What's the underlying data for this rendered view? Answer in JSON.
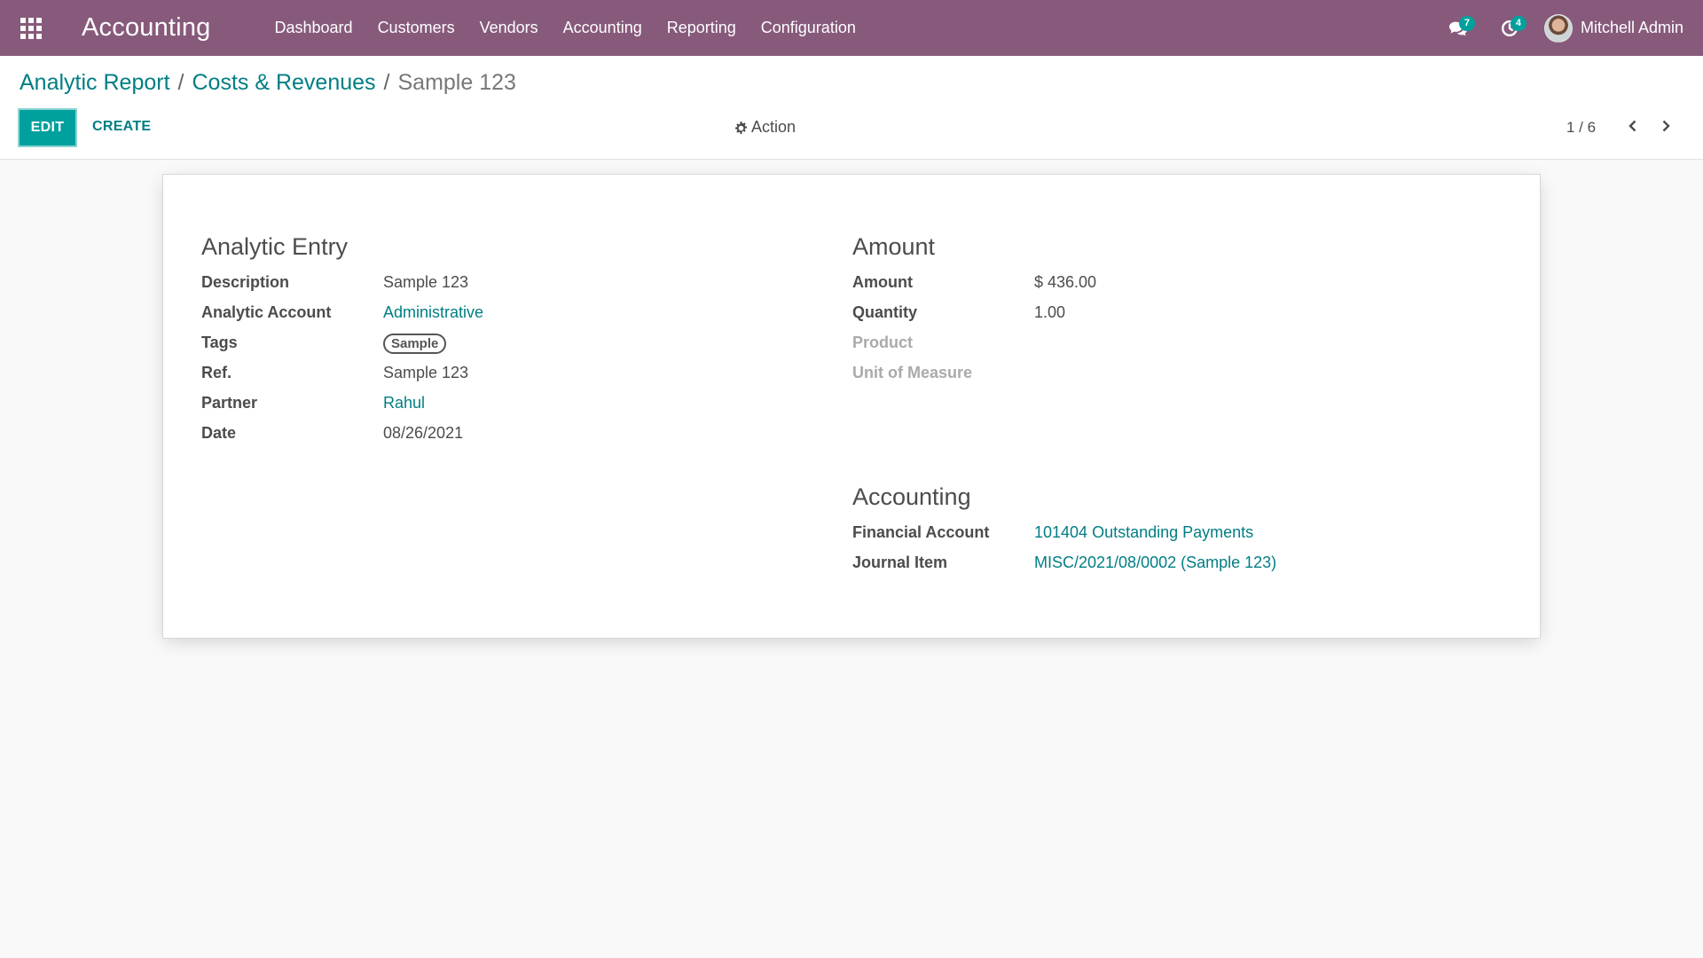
{
  "navbar": {
    "app_title": "Accounting",
    "menu": [
      "Dashboard",
      "Customers",
      "Vendors",
      "Accounting",
      "Reporting",
      "Configuration"
    ],
    "messages_count": "7",
    "activities_count": "4",
    "user_name": "Mitchell Admin"
  },
  "control_panel": {
    "breadcrumb": [
      "Analytic Report",
      "Costs & Revenues",
      "Sample 123"
    ],
    "edit_label": "EDIT",
    "create_label": "CREATE",
    "action_label": "Action",
    "pager": "1 / 6"
  },
  "form": {
    "entry": {
      "title": "Analytic Entry",
      "description_label": "Description",
      "description": "Sample 123",
      "account_label": "Analytic Account",
      "account": "Administrative",
      "tags_label": "Tags",
      "tag": "Sample",
      "ref_label": "Ref.",
      "ref": "Sample 123",
      "partner_label": "Partner",
      "partner": "Rahul",
      "date_label": "Date",
      "date": "08/26/2021"
    },
    "amount": {
      "title": "Amount",
      "amount_label": "Amount",
      "amount": "$ 436.00",
      "quantity_label": "Quantity",
      "quantity": "1.00",
      "product_label": "Product",
      "uom_label": "Unit of Measure"
    },
    "accounting": {
      "title": "Accounting",
      "financial_account_label": "Financial Account",
      "financial_account": "101404 Outstanding Payments",
      "journal_item_label": "Journal Item",
      "journal_item": "MISC/2021/08/0002 (Sample 123)"
    }
  },
  "colors": {
    "navbar": "#875a7b",
    "primary": "#00a09d",
    "link": "#017e84"
  }
}
